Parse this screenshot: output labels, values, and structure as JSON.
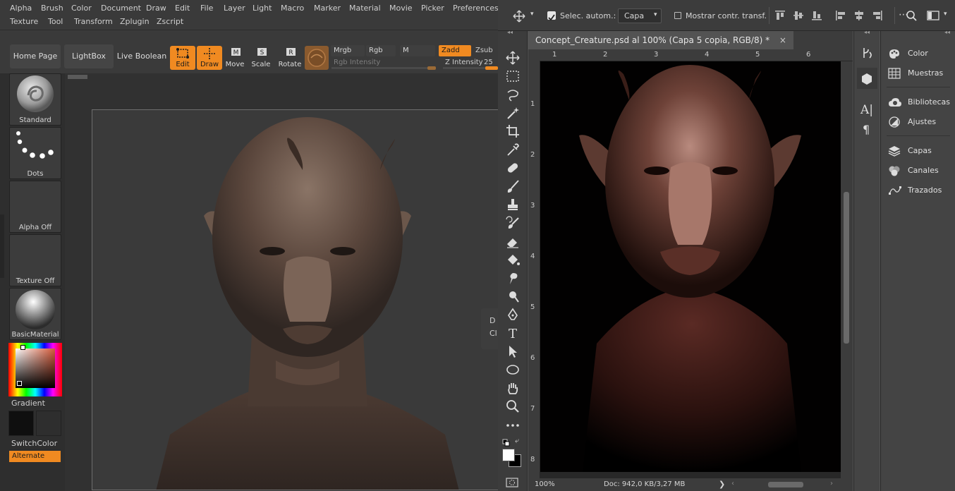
{
  "zbrush": {
    "menus_row1": [
      "Alpha",
      "Brush",
      "Color",
      "Document",
      "Draw",
      "Edit",
      "File",
      "Layer",
      "Light",
      "Macro",
      "Marker",
      "Material",
      "Movie",
      "Picker",
      "Preferences"
    ],
    "menus_row2": [
      "Texture",
      "Tool",
      "Transform",
      "Zplugin",
      "Zscript"
    ],
    "buttons": {
      "home_page": "Home Page",
      "lightbox": "LightBox",
      "live_boolean": "Live Boolean"
    },
    "tools": [
      {
        "label": "Edit",
        "active": true
      },
      {
        "label": "Draw",
        "active": true
      },
      {
        "label": "Move",
        "active": false,
        "key": "M"
      },
      {
        "label": "Scale",
        "active": false,
        "key": "S"
      },
      {
        "label": "Rotate",
        "active": false,
        "key": "R"
      }
    ],
    "color_modes": {
      "mrgb": "Mrgb",
      "rgb": "Rgb",
      "m": "M"
    },
    "rgb_intensity_label": "Rgb Intensity",
    "zadd": "Zadd",
    "zsub": "Zsub",
    "z_intensity_label": "Z Intensity",
    "z_intensity_value": "25",
    "side_slots": {
      "brush": "Standard",
      "stroke": "Dots",
      "alpha": "Alpha Off",
      "texture": "Texture Off",
      "material": "BasicMaterial"
    },
    "gradient_label": "Gradient",
    "switchcolor_label": "SwitchColor",
    "alternate_label": "Alternate",
    "tooltip_partial": [
      "D",
      "Cl"
    ]
  },
  "photoshop": {
    "auto_select_label": "Selec. autom.:",
    "auto_select_checked": true,
    "auto_select_target": "Capa",
    "show_transform_label": "Mostrar contr. transf.",
    "show_transform_checked": false,
    "document_tab": "Concept_Creature.psd al 100% (Capa 5 copia, RGB/8) *",
    "ruler_top": [
      "1",
      "2",
      "3",
      "4",
      "5",
      "6"
    ],
    "ruler_left": [
      "1",
      "2",
      "3",
      "4",
      "5",
      "6",
      "7",
      "8"
    ],
    "zoom": "100%",
    "doc_size": "Doc: 942,0 KB/3,27 MB",
    "panels": [
      {
        "label": "Color",
        "icon": "color-palette-icon"
      },
      {
        "label": "Muestras",
        "icon": "swatches-grid-icon"
      },
      {
        "label": "Bibliotecas",
        "icon": "libraries-cloud-icon"
      },
      {
        "label": "Ajustes",
        "icon": "adjustments-icon"
      },
      {
        "label": "Capas",
        "icon": "layers-icon"
      },
      {
        "label": "Canales",
        "icon": "channels-icon"
      },
      {
        "label": "Trazados",
        "icon": "paths-icon"
      }
    ]
  },
  "colors": {
    "zbrush_accent": "#f08a21",
    "ps_bg": "#535353",
    "ps_panel": "#444444",
    "zbrush_bg": "#343434"
  }
}
